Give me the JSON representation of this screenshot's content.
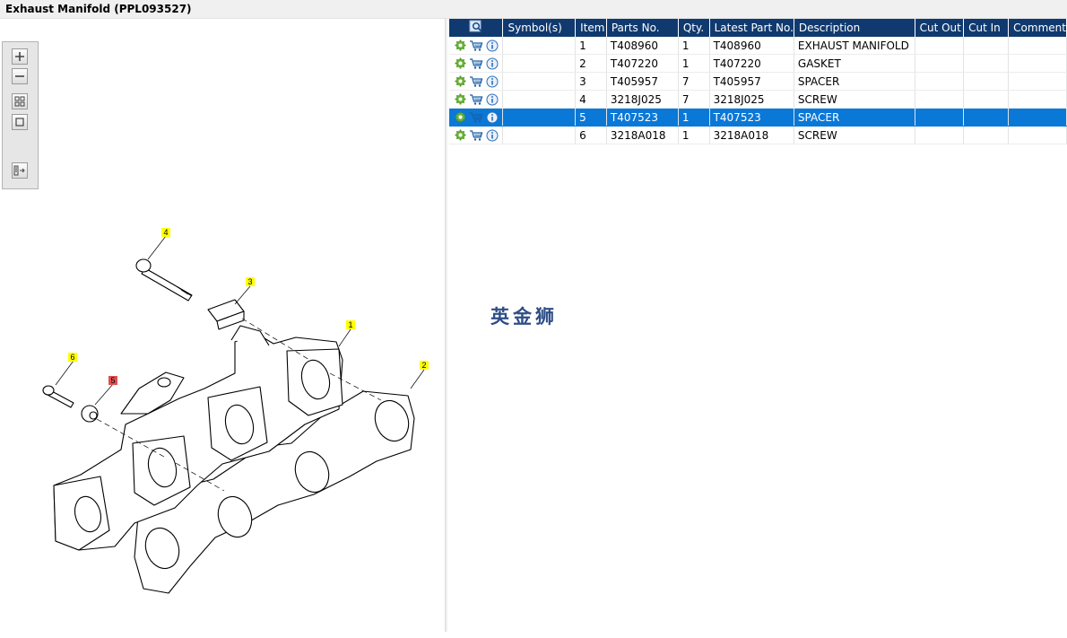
{
  "window": {
    "title": "Exhaust Manifold (PPL093527)"
  },
  "toolbar": {
    "zoom_in": "zoom-in",
    "zoom_out": "zoom-out",
    "fit": "fit-to-window",
    "actual": "actual-size",
    "toggle": "toggle-panel"
  },
  "table": {
    "columns": [
      "Symbol(s)",
      "Item",
      "Parts No.",
      "Qty.",
      "Latest Part No.",
      "Description",
      "Cut Out",
      "Cut In",
      "Comment"
    ],
    "rows": [
      {
        "item": "1",
        "part_no": "T408960",
        "qty": "1",
        "latest": "T408960",
        "desc": "EXHAUST MANIFOLD"
      },
      {
        "item": "2",
        "part_no": "T407220",
        "qty": "1",
        "latest": "T407220",
        "desc": "GASKET"
      },
      {
        "item": "3",
        "part_no": "T405957",
        "qty": "7",
        "latest": "T405957",
        "desc": "SPACER"
      },
      {
        "item": "4",
        "part_no": "3218J025",
        "qty": "7",
        "latest": "3218J025",
        "desc": "SCREW"
      },
      {
        "item": "5",
        "part_no": "T407523",
        "qty": "1",
        "latest": "T407523",
        "desc": "SPACER"
      },
      {
        "item": "6",
        "part_no": "3218A018",
        "qty": "1",
        "latest": "3218A018",
        "desc": "SCREW"
      }
    ],
    "selected_row": 4
  },
  "watermark": "英金狮",
  "callouts": {
    "c1": "1",
    "c2": "2",
    "c3": "3",
    "c4": "4",
    "c5": "5",
    "c6": "6"
  },
  "colors": {
    "header": "#103a6f",
    "selected": "#0a78d7",
    "callout": "#ffff00",
    "callout_selected": "#e05050"
  }
}
